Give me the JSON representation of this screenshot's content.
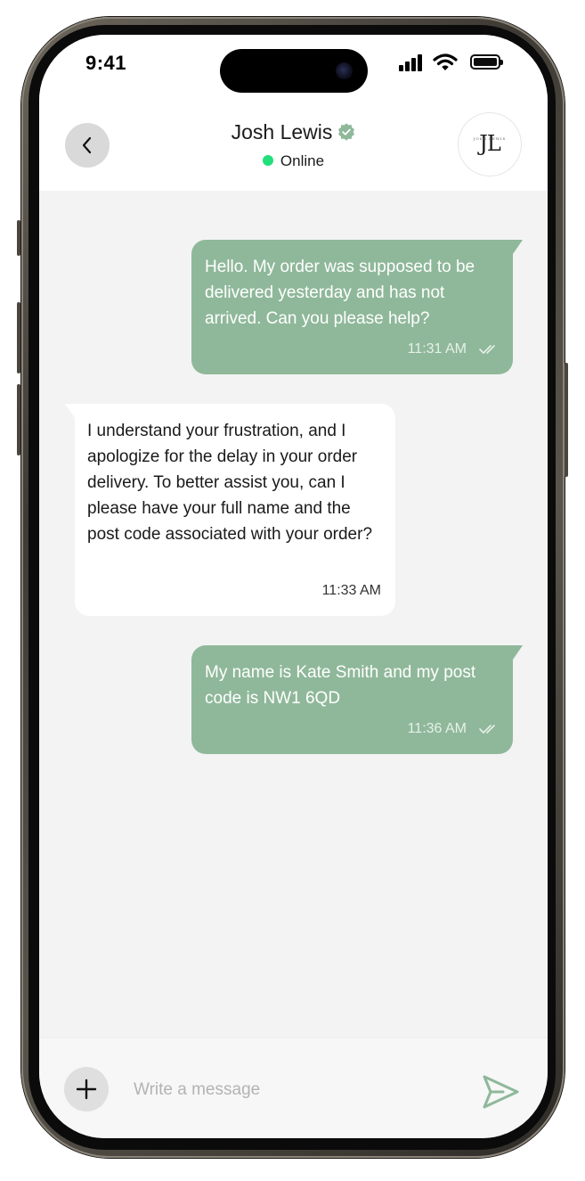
{
  "status_bar": {
    "time": "9:41",
    "icons": [
      "signal-icon",
      "wifi-icon",
      "battery-icon"
    ]
  },
  "header": {
    "back_icon": "chevron-left-icon",
    "contact_name": "Josh Lewis",
    "verified_icon": "verified-badge-icon",
    "presence": "Online",
    "presence_color": "#1fe07a",
    "avatar_monogram": "JL",
    "avatar_caption": "JOSH LEWIS"
  },
  "messages": [
    {
      "direction": "outgoing",
      "text": "Hello. My order was supposed to be delivered yesterday and has not arrived. Can you please help?",
      "time": "11:31 AM",
      "read_icon": "double-check-icon"
    },
    {
      "direction": "incoming",
      "text": "I understand your frustration, and I apologize for the delay in your order delivery. To better assist you, can I please have your full name and the post code associated with your order?",
      "time": "11:33 AM"
    },
    {
      "direction": "outgoing",
      "text": "My name is Kate Smith and my post code is NW1 6QD",
      "time": "11:36 AM",
      "read_icon": "double-check-icon"
    }
  ],
  "composer": {
    "add_icon": "plus-icon",
    "placeholder": "Write a message",
    "value": "",
    "send_icon": "send-icon"
  },
  "colors": {
    "accent": "#8fb89a",
    "chat_background": "#f3f3f3",
    "incoming_bubble": "#ffffff"
  }
}
